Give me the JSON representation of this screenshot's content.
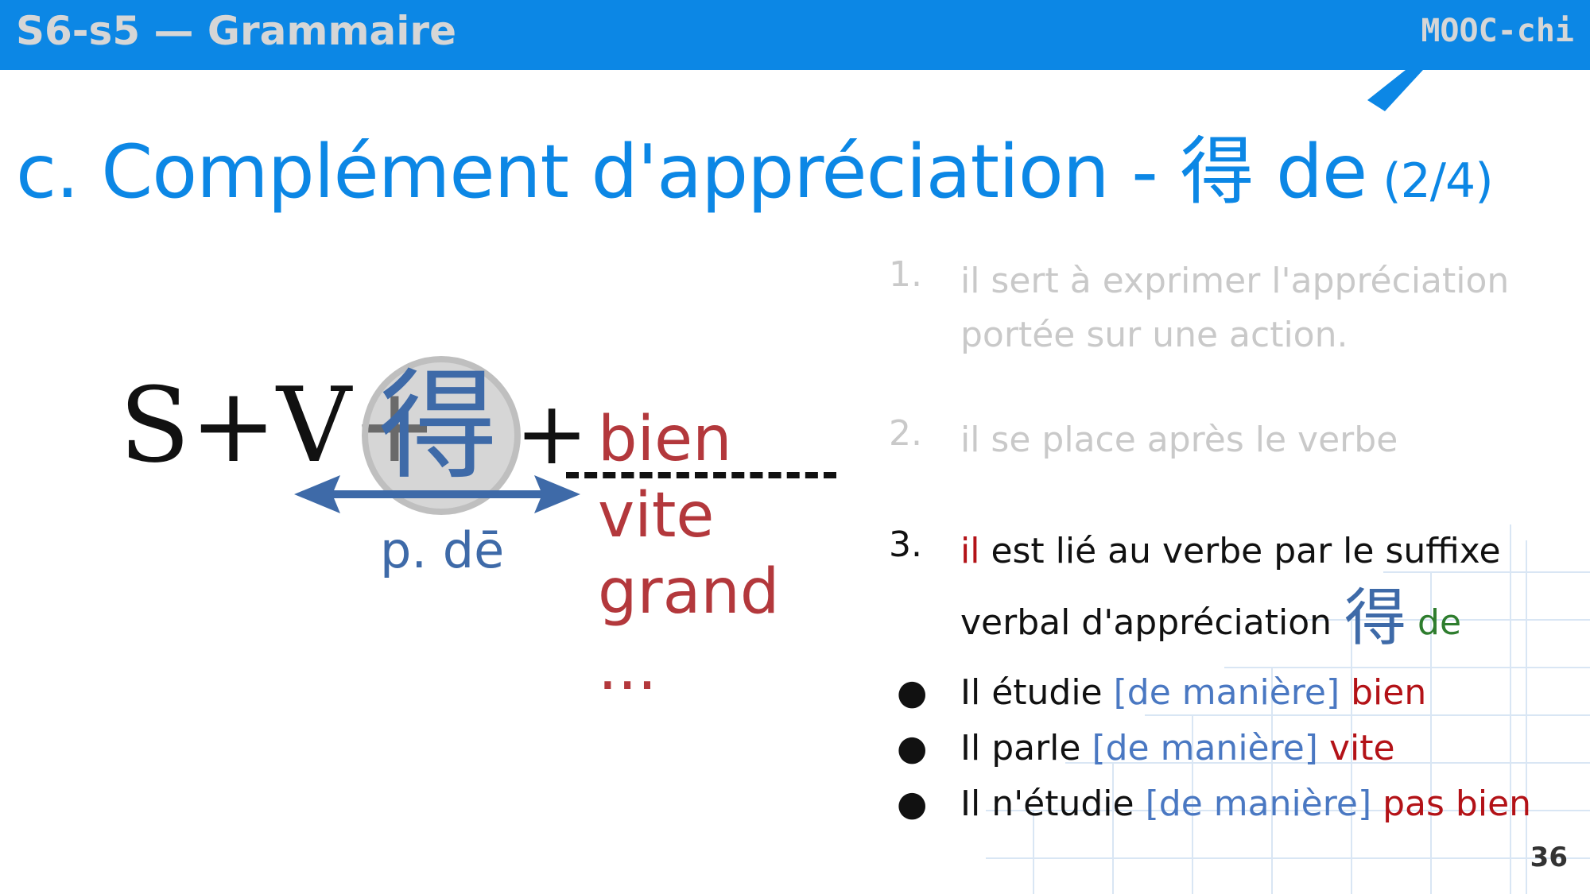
{
  "header": {
    "title": "S6-s5 — Grammaire",
    "brand": "MOOC-chi"
  },
  "slide": {
    "title_main": "c. Complément d'appréciation - 得 de",
    "title_fraction": "(2/4)",
    "page_number": "36"
  },
  "formula": {
    "prefix": "S+V+",
    "de_char": "得",
    "plus": "+",
    "pinyin": "p. dē",
    "examples": [
      "bien",
      "vite",
      "grand",
      "..."
    ]
  },
  "points": [
    {
      "num": "1.",
      "text": "il sert à exprimer l'appréciation portée sur une action."
    },
    {
      "num": "2.",
      "text": "il se place après le verbe"
    },
    {
      "num": "3.",
      "text_il": "il",
      "text_rest": " est lié au verbe par le suffixe",
      "text_line2": "verbal d'appréciation",
      "de_char": "得",
      "de_pinyin": "de"
    }
  ],
  "bullets": [
    {
      "dot": "●",
      "subject": "Il étudie ",
      "manner": "[de manière]",
      "value": " bien"
    },
    {
      "dot": "●",
      "subject": "Il parle ",
      "manner": "[de manière]",
      "value": " vite"
    },
    {
      "dot": "●",
      "subject": "Il n'étudie ",
      "manner": "[de manière]",
      "value": " pas bien"
    }
  ],
  "colors": {
    "header_bg": "#0c87e5",
    "title": "#0c87e5",
    "de_blue": "#3e6aa8",
    "example_red": "#b3383c",
    "faded": "#c9c9c9"
  }
}
